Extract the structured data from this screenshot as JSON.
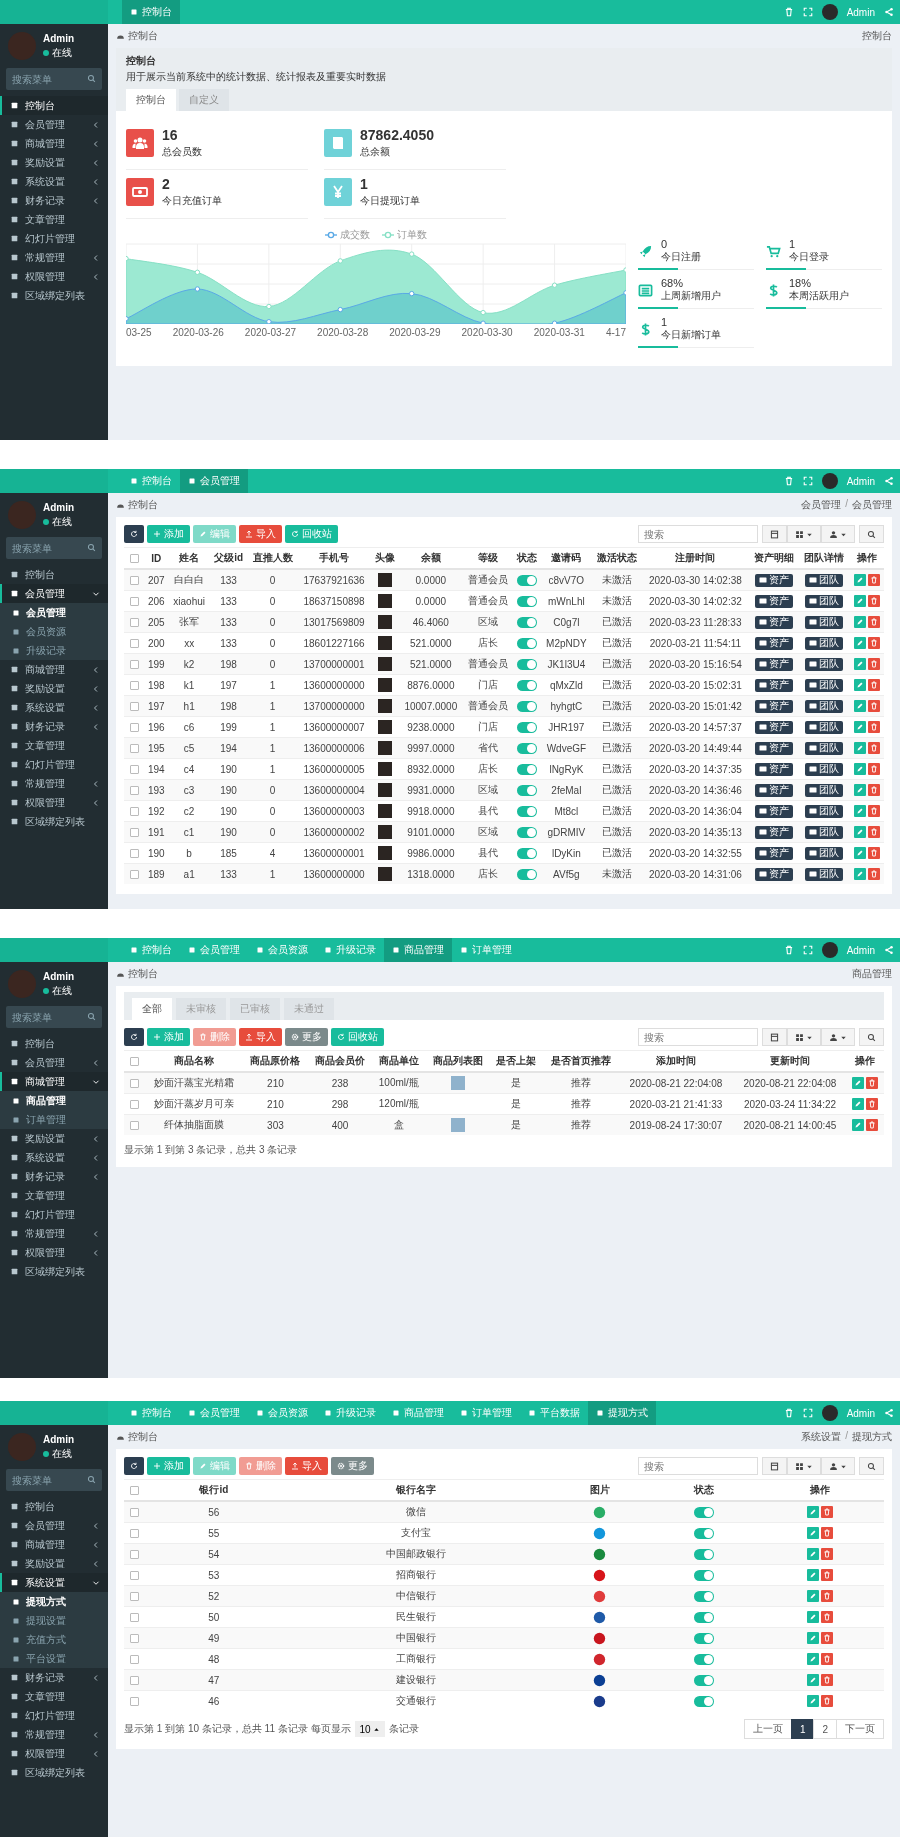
{
  "panels": [
    {
      "user": {
        "name": "Admin",
        "status": "在线"
      },
      "sidebar": {
        "search_placeholder": "搜索菜单",
        "items": [
          {
            "label": "控制台",
            "kind": "link",
            "selected": true
          },
          {
            "label": "会员管理",
            "kind": "group",
            "expanded": false,
            "selected": false
          },
          {
            "label": "商城管理",
            "kind": "group",
            "expanded": false,
            "selected": false
          },
          {
            "label": "奖励设置",
            "kind": "group",
            "expanded": false,
            "selected": false
          },
          {
            "label": "系统设置",
            "kind": "group",
            "expanded": false,
            "selected": false
          },
          {
            "label": "财务记录",
            "kind": "group",
            "expanded": false,
            "selected": false
          },
          {
            "label": "文章管理",
            "kind": "link",
            "selected": false
          },
          {
            "label": "幻灯片管理",
            "kind": "link",
            "selected": false
          },
          {
            "label": "常规管理",
            "kind": "group",
            "expanded": false,
            "selected": false
          },
          {
            "label": "权限管理",
            "kind": "group",
            "expanded": false,
            "selected": false
          },
          {
            "label": "区域绑定列表",
            "kind": "link",
            "selected": false
          }
        ]
      },
      "topbar": {
        "tabs": [
          {
            "label": "控制台",
            "selected": true
          }
        ],
        "user_name": "Admin"
      },
      "breadcrumb": {
        "home": "控制台",
        "trail": [
          "控制台"
        ]
      },
      "content": {
        "kind": "dashboard",
        "title": "控制台",
        "description": "用于展示当前系统中的统计数据、统计报表及重要实时数据",
        "tabs": [
          {
            "label": "控制台",
            "selected": true
          },
          {
            "label": "自定义",
            "selected": false
          }
        ],
        "stats": [
          {
            "value": "16",
            "label": "总会员数",
            "color": "#e8504a"
          },
          {
            "value": "87862.4050",
            "label": "总余额",
            "color": "#6fd2d8"
          },
          {
            "value": "2",
            "label": "今日充值订单",
            "color": "#e8504a"
          },
          {
            "value": "1",
            "label": "今日提现订单",
            "color": "#6fd2d8"
          }
        ],
        "chart": {
          "legend": [
            "成交数",
            "订单数"
          ],
          "x_labels": [
            "03-25",
            "2020-03-26",
            "2020-03-27",
            "2020-03-28",
            "2020-03-29",
            "2020-03-30",
            "2020-03-31",
            "4-17"
          ]
        },
        "mini_stats": [
          {
            "value": "0",
            "label": "今日注册"
          },
          {
            "value": "1",
            "label": "今日登录"
          },
          {
            "value": "68%",
            "label": "上周新增用户"
          },
          {
            "value": "18%",
            "label": "本周活跃用户"
          },
          {
            "value": "1",
            "label": "今日新增订单"
          }
        ]
      }
    },
    {
      "user": {
        "name": "Admin",
        "status": "在线"
      },
      "sidebar": {
        "search_placeholder": "搜索菜单",
        "items": [
          {
            "label": "控制台",
            "kind": "link",
            "selected": false
          },
          {
            "label": "会员管理",
            "kind": "group",
            "expanded": true,
            "selected": true,
            "children": [
              {
                "label": "会员管理",
                "selected": true
              },
              {
                "label": "会员资源",
                "selected": false
              },
              {
                "label": "升级记录",
                "selected": false
              }
            ]
          },
          {
            "label": "商城管理",
            "kind": "group",
            "expanded": false,
            "selected": false
          },
          {
            "label": "奖励设置",
            "kind": "group",
            "expanded": false,
            "selected": false
          },
          {
            "label": "系统设置",
            "kind": "group",
            "expanded": false,
            "selected": false
          },
          {
            "label": "财务记录",
            "kind": "group",
            "expanded": false,
            "selected": false
          },
          {
            "label": "文章管理",
            "kind": "link",
            "selected": false
          },
          {
            "label": "幻灯片管理",
            "kind": "link",
            "selected": false
          },
          {
            "label": "常规管理",
            "kind": "group",
            "expanded": false,
            "selected": false
          },
          {
            "label": "权限管理",
            "kind": "group",
            "expanded": false,
            "selected": false
          },
          {
            "label": "区域绑定列表",
            "kind": "link",
            "selected": false
          }
        ]
      },
      "topbar": {
        "tabs": [
          {
            "label": "控制台",
            "selected": false
          },
          {
            "label": "会员管理",
            "selected": true
          }
        ],
        "user_name": "Admin"
      },
      "breadcrumb": {
        "home": "控制台",
        "separator": "/",
        "trail": [
          "会员管理",
          "会员管理"
        ]
      },
      "content": {
        "kind": "table",
        "search_placeholder": "搜索",
        "toolbar": [
          {
            "kind": "refresh",
            "disabled": false
          },
          {
            "kind": "add",
            "label": "添加",
            "disabled": false
          },
          {
            "kind": "edit",
            "label": "编辑",
            "disabled": true
          },
          {
            "kind": "import",
            "label": "导入",
            "disabled": false
          },
          {
            "kind": "recycle",
            "label": "回收站",
            "disabled": false
          }
        ],
        "header_checked": false,
        "columns": [
          "ID",
          "姓名",
          "父级id",
          "直推人数",
          "手机号",
          "头像",
          "余额",
          "等级",
          "状态",
          "邀请码",
          "激活状态",
          "注册时间",
          "资产明细",
          "团队详情",
          "操作"
        ],
        "rows": [
          {
            "checked": false,
            "cells": [
              "207",
              "白白白",
              "133",
              "0",
              "17637921636",
              {
                "kind": "avatar"
              },
              "0.0000",
              "普通会员",
              {
                "kind": "toggle",
                "on": true
              },
              "c8vV7O",
              "未激活",
              "2020-03-30 14:02:38",
              {
                "kind": "tag",
                "text": "资产"
              },
              {
                "kind": "tag",
                "text": "团队"
              },
              {
                "kind": "actions"
              }
            ]
          },
          {
            "checked": false,
            "cells": [
              "206",
              "xiaohui",
              "133",
              "0",
              "18637150898",
              {
                "kind": "avatar"
              },
              "0.0000",
              "普通会员",
              {
                "kind": "toggle",
                "on": true
              },
              "mWnLhl",
              "未激活",
              "2020-03-30 14:02:32",
              {
                "kind": "tag",
                "text": "资产"
              },
              {
                "kind": "tag",
                "text": "团队"
              },
              {
                "kind": "actions"
              }
            ]
          },
          {
            "checked": false,
            "cells": [
              "205",
              "张军",
              "133",
              "0",
              "13017569809",
              {
                "kind": "avatar"
              },
              "46.4060",
              "区域",
              {
                "kind": "toggle",
                "on": true
              },
              "C0g7l",
              "已激活",
              "2020-03-23 11:28:33",
              {
                "kind": "tag",
                "text": "资产"
              },
              {
                "kind": "tag",
                "text": "团队"
              },
              {
                "kind": "actions"
              }
            ]
          },
          {
            "checked": false,
            "cells": [
              "200",
              "xx",
              "133",
              "0",
              "18601227166",
              {
                "kind": "avatar"
              },
              "521.0000",
              "店长",
              {
                "kind": "toggle",
                "on": true
              },
              "M2pNDY",
              "已激活",
              "2020-03-21 11:54:11",
              {
                "kind": "tag",
                "text": "资产"
              },
              {
                "kind": "tag",
                "text": "团队"
              },
              {
                "kind": "actions"
              }
            ]
          },
          {
            "checked": false,
            "cells": [
              "199",
              "k2",
              "198",
              "0",
              "13700000001",
              {
                "kind": "avatar"
              },
              "521.0000",
              "普通会员",
              {
                "kind": "toggle",
                "on": true
              },
              "JK1l3U4",
              "已激活",
              "2020-03-20 15:16:54",
              {
                "kind": "tag",
                "text": "资产"
              },
              {
                "kind": "tag",
                "text": "团队"
              },
              {
                "kind": "actions"
              }
            ]
          },
          {
            "checked": false,
            "cells": [
              "198",
              "k1",
              "197",
              "1",
              "13600000000",
              {
                "kind": "avatar"
              },
              "8876.0000",
              "门店",
              {
                "kind": "toggle",
                "on": true
              },
              "qMxZld",
              "已激活",
              "2020-03-20 15:02:31",
              {
                "kind": "tag",
                "text": "资产"
              },
              {
                "kind": "tag",
                "text": "团队"
              },
              {
                "kind": "actions"
              }
            ]
          },
          {
            "checked": false,
            "cells": [
              "197",
              "h1",
              "198",
              "1",
              "13700000000",
              {
                "kind": "avatar"
              },
              "10007.0000",
              "普通会员",
              {
                "kind": "toggle",
                "on": true
              },
              "hyhgtC",
              "已激活",
              "2020-03-20 15:01:42",
              {
                "kind": "tag",
                "text": "资产"
              },
              {
                "kind": "tag",
                "text": "团队"
              },
              {
                "kind": "actions"
              }
            ]
          },
          {
            "checked": false,
            "cells": [
              "196",
              "c6",
              "199",
              "1",
              "13600000007",
              {
                "kind": "avatar"
              },
              "9238.0000",
              "门店",
              {
                "kind": "toggle",
                "on": true
              },
              "JHR197",
              "已激活",
              "2020-03-20 14:57:37",
              {
                "kind": "tag",
                "text": "资产"
              },
              {
                "kind": "tag",
                "text": "团队"
              },
              {
                "kind": "actions"
              }
            ]
          },
          {
            "checked": false,
            "cells": [
              "195",
              "c5",
              "194",
              "1",
              "13600000006",
              {
                "kind": "avatar"
              },
              "9997.0000",
              "省代",
              {
                "kind": "toggle",
                "on": true
              },
              "WdveGF",
              "已激活",
              "2020-03-20 14:49:44",
              {
                "kind": "tag",
                "text": "资产"
              },
              {
                "kind": "tag",
                "text": "团队"
              },
              {
                "kind": "actions"
              }
            ]
          },
          {
            "checked": false,
            "cells": [
              "194",
              "c4",
              "190",
              "1",
              "13600000005",
              {
                "kind": "avatar"
              },
              "8932.0000",
              "店长",
              {
                "kind": "toggle",
                "on": true
              },
              "lNgRyK",
              "已激活",
              "2020-03-20 14:37:35",
              {
                "kind": "tag",
                "text": "资产"
              },
              {
                "kind": "tag",
                "text": "团队"
              },
              {
                "kind": "actions"
              }
            ]
          },
          {
            "checked": false,
            "cells": [
              "193",
              "c3",
              "190",
              "0",
              "13600000004",
              {
                "kind": "avatar"
              },
              "9931.0000",
              "区域",
              {
                "kind": "toggle",
                "on": true
              },
              "2feMal",
              "已激活",
              "2020-03-20 14:36:46",
              {
                "kind": "tag",
                "text": "资产"
              },
              {
                "kind": "tag",
                "text": "团队"
              },
              {
                "kind": "actions"
              }
            ]
          },
          {
            "checked": false,
            "cells": [
              "192",
              "c2",
              "190",
              "0",
              "13600000003",
              {
                "kind": "avatar"
              },
              "9918.0000",
              "县代",
              {
                "kind": "toggle",
                "on": true
              },
              "Mt8cl",
              "已激活",
              "2020-03-20 14:36:04",
              {
                "kind": "tag",
                "text": "资产"
              },
              {
                "kind": "tag",
                "text": "团队"
              },
              {
                "kind": "actions"
              }
            ]
          },
          {
            "checked": false,
            "cells": [
              "191",
              "c1",
              "190",
              "0",
              "13600000002",
              {
                "kind": "avatar"
              },
              "9101.0000",
              "区域",
              {
                "kind": "toggle",
                "on": true
              },
              "gDRMIV",
              "已激活",
              "2020-03-20 14:35:13",
              {
                "kind": "tag",
                "text": "资产"
              },
              {
                "kind": "tag",
                "text": "团队"
              },
              {
                "kind": "actions"
              }
            ]
          },
          {
            "checked": false,
            "cells": [
              "190",
              "b",
              "185",
              "4",
              "13600000001",
              {
                "kind": "avatar"
              },
              "9986.0000",
              "县代",
              {
                "kind": "toggle",
                "on": true
              },
              "lDyKin",
              "已激活",
              "2020-03-20 14:32:55",
              {
                "kind": "tag",
                "text": "资产"
              },
              {
                "kind": "tag",
                "text": "团队"
              },
              {
                "kind": "actions"
              }
            ]
          },
          {
            "checked": false,
            "cells": [
              "189",
              "a1",
              "133",
              "1",
              "13600000000",
              {
                "kind": "avatar"
              },
              "1318.0000",
              "店长",
              {
                "kind": "toggle",
                "on": true
              },
              "AVf5g",
              "未激活",
              "2020-03-20 14:31:06",
              {
                "kind": "tag",
                "text": "资产"
              },
              {
                "kind": "tag",
                "text": "团队"
              },
              {
                "kind": "actions"
              }
            ]
          }
        ]
      }
    },
    {
      "user": {
        "name": "Admin",
        "status": "在线"
      },
      "sidebar": {
        "search_placeholder": "搜索菜单",
        "items": [
          {
            "label": "控制台",
            "kind": "link",
            "selected": false
          },
          {
            "label": "会员管理",
            "kind": "group",
            "expanded": false,
            "selected": false
          },
          {
            "label": "商城管理",
            "kind": "group",
            "expanded": true,
            "selected": true,
            "children": [
              {
                "label": "商品管理",
                "selected": true
              },
              {
                "label": "订单管理",
                "selected": false
              }
            ]
          },
          {
            "label": "奖励设置",
            "kind": "group",
            "expanded": false,
            "selected": false
          },
          {
            "label": "系统设置",
            "kind": "group",
            "expanded": false,
            "selected": false
          },
          {
            "label": "财务记录",
            "kind": "group",
            "expanded": false,
            "selected": false
          },
          {
            "label": "文章管理",
            "kind": "link",
            "selected": false
          },
          {
            "label": "幻灯片管理",
            "kind": "link",
            "selected": false
          },
          {
            "label": "常规管理",
            "kind": "group",
            "expanded": false,
            "selected": false
          },
          {
            "label": "权限管理",
            "kind": "group",
            "expanded": false,
            "selected": false
          },
          {
            "label": "区域绑定列表",
            "kind": "link",
            "selected": false
          }
        ]
      },
      "topbar": {
        "tabs": [
          {
            "label": "控制台",
            "selected": false
          },
          {
            "label": "会员管理",
            "selected": false
          },
          {
            "label": "会员资源",
            "selected": false
          },
          {
            "label": "升级记录",
            "selected": false
          },
          {
            "label": "商品管理",
            "selected": true
          },
          {
            "label": "订单管理",
            "selected": false
          }
        ],
        "user_name": "Admin"
      },
      "breadcrumb": {
        "home": "控制台",
        "trail": [
          "商品管理"
        ]
      },
      "content": {
        "kind": "table",
        "search_placeholder": "搜索",
        "filter_tabs": [
          {
            "label": "全部",
            "selected": true
          },
          {
            "label": "未审核",
            "selected": false
          },
          {
            "label": "已审核",
            "selected": false
          },
          {
            "label": "未通过",
            "selected": false
          }
        ],
        "toolbar": [
          {
            "kind": "refresh",
            "disabled": false
          },
          {
            "kind": "add",
            "label": "添加",
            "disabled": false
          },
          {
            "kind": "delete",
            "label": "删除",
            "disabled": true
          },
          {
            "kind": "import",
            "label": "导入",
            "disabled": false
          },
          {
            "kind": "more",
            "label": "更多",
            "disabled": false
          },
          {
            "kind": "recycle",
            "label": "回收站",
            "disabled": false
          }
        ],
        "header_checked": false,
        "columns": [
          "商品名称",
          "商品原价格",
          "商品会员价",
          "商品单位",
          "商品列表图",
          "是否上架",
          "是否首页推荐",
          "添加时间",
          "更新时间",
          "操作"
        ],
        "rows": [
          {
            "checked": false,
            "cells": [
              "妙面汗蒸宝光精霜",
              "210",
              "238",
              "100ml/瓶",
              {
                "kind": "image"
              },
              "是",
              "推荐",
              "2020-08-21 22:04:08",
              "2020-08-21 22:04:08",
              {
                "kind": "actions"
              }
            ]
          },
          {
            "checked": false,
            "cells": [
              "妙面汗蒸岁月可亲",
              "210",
              "298",
              "120ml/瓶",
              {
                "kind": "empty"
              },
              "是",
              "推荐",
              "2020-03-21 21:41:33",
              "2020-03-24 11:34:22",
              {
                "kind": "actions"
              }
            ]
          },
          {
            "checked": false,
            "cells": [
              "纤体抽脂面膜",
              "303",
              "400",
              "盒",
              {
                "kind": "image"
              },
              "是",
              "推荐",
              "2019-08-24 17:30:07",
              "2020-08-21 14:00:45",
              {
                "kind": "actions"
              }
            ]
          }
        ],
        "footer": {
          "summary": "显示第 1 到第 3 条记录，总共 3 条记录"
        }
      }
    },
    {
      "user": {
        "name": "Admin",
        "status": "在线"
      },
      "sidebar": {
        "search_placeholder": "搜索菜单",
        "items": [
          {
            "label": "控制台",
            "kind": "link",
            "selected": false
          },
          {
            "label": "会员管理",
            "kind": "group",
            "expanded": false,
            "selected": false
          },
          {
            "label": "商城管理",
            "kind": "group",
            "expanded": false,
            "selected": false
          },
          {
            "label": "奖励设置",
            "kind": "group",
            "expanded": false,
            "selected": false
          },
          {
            "label": "系统设置",
            "kind": "group",
            "expanded": true,
            "selected": true,
            "children": [
              {
                "label": "提现方式",
                "selected": true
              },
              {
                "label": "提现设置",
                "selected": false
              },
              {
                "label": "充值方式",
                "selected": false
              },
              {
                "label": "平台设置",
                "selected": false
              }
            ]
          },
          {
            "label": "财务记录",
            "kind": "group",
            "expanded": false,
            "selected": false
          },
          {
            "label": "文章管理",
            "kind": "link",
            "selected": false
          },
          {
            "label": "幻灯片管理",
            "kind": "link",
            "selected": false
          },
          {
            "label": "常规管理",
            "kind": "group",
            "expanded": false,
            "selected": false
          },
          {
            "label": "权限管理",
            "kind": "group",
            "expanded": false,
            "selected": false
          },
          {
            "label": "区域绑定列表",
            "kind": "link",
            "selected": false
          }
        ]
      },
      "topbar": {
        "tabs": [
          {
            "label": "控制台",
            "selected": false
          },
          {
            "label": "会员管理",
            "selected": false
          },
          {
            "label": "会员资源",
            "selected": false
          },
          {
            "label": "升级记录",
            "selected": false
          },
          {
            "label": "商品管理",
            "selected": false
          },
          {
            "label": "订单管理",
            "selected": false
          },
          {
            "label": "平台数据",
            "selected": false
          },
          {
            "label": "提现方式",
            "selected": true
          }
        ],
        "user_name": "Admin"
      },
      "breadcrumb": {
        "home": "控制台",
        "separator": "/",
        "trail": [
          "系统设置",
          "提现方式"
        ]
      },
      "content": {
        "kind": "table",
        "search_placeholder": "搜索",
        "toolbar": [
          {
            "kind": "refresh",
            "disabled": false
          },
          {
            "kind": "add",
            "label": "添加",
            "disabled": false
          },
          {
            "kind": "edit",
            "label": "编辑",
            "disabled": true
          },
          {
            "kind": "delete",
            "label": "删除",
            "disabled": true
          },
          {
            "kind": "import",
            "label": "导入",
            "disabled": false
          },
          {
            "kind": "more",
            "label": "更多",
            "disabled": false
          }
        ],
        "header_checked": false,
        "columns": [
          "银行id",
          "银行名字",
          "图片",
          "状态",
          "操作"
        ],
        "rows": [
          {
            "checked": false,
            "cells": [
              "56",
              "微信",
              {
                "kind": "logo",
                "color": "#2aae67"
              },
              {
                "kind": "toggle",
                "on": true
              },
              {
                "kind": "actions"
              }
            ]
          },
          {
            "checked": false,
            "cells": [
              "55",
              "支付宝",
              {
                "kind": "logo",
                "color": "#1296db"
              },
              {
                "kind": "toggle",
                "on": true
              },
              {
                "kind": "actions"
              }
            ]
          },
          {
            "checked": false,
            "cells": [
              "54",
              "中国邮政银行",
              {
                "kind": "logo",
                "color": "#1a8a3f"
              },
              {
                "kind": "toggle",
                "on": true
              },
              {
                "kind": "actions"
              }
            ]
          },
          {
            "checked": false,
            "cells": [
              "53",
              "招商银行",
              {
                "kind": "logo",
                "color": "#d7141a"
              },
              {
                "kind": "toggle",
                "on": true
              },
              {
                "kind": "actions"
              }
            ]
          },
          {
            "checked": false,
            "cells": [
              "52",
              "中信银行",
              {
                "kind": "logo",
                "color": "#e03c3c"
              },
              {
                "kind": "toggle",
                "on": true
              },
              {
                "kind": "actions"
              }
            ]
          },
          {
            "checked": false,
            "cells": [
              "50",
              "民生银行",
              {
                "kind": "logo",
                "color": "#1f5aa8"
              },
              {
                "kind": "toggle",
                "on": true
              },
              {
                "kind": "actions"
              }
            ]
          },
          {
            "checked": false,
            "cells": [
              "49",
              "中国银行",
              {
                "kind": "logo",
                "color": "#c8161e"
              },
              {
                "kind": "toggle",
                "on": true
              },
              {
                "kind": "actions"
              }
            ]
          },
          {
            "checked": false,
            "cells": [
              "48",
              "工商银行",
              {
                "kind": "logo",
                "color": "#d0262d"
              },
              {
                "kind": "toggle",
                "on": true
              },
              {
                "kind": "actions"
              }
            ]
          },
          {
            "checked": false,
            "cells": [
              "47",
              "建设银行",
              {
                "kind": "logo",
                "color": "#0b3f94"
              },
              {
                "kind": "toggle",
                "on": true
              },
              {
                "kind": "actions"
              }
            ]
          },
          {
            "checked": false,
            "cells": [
              "46",
              "交通银行",
              {
                "kind": "logo",
                "color": "#1a3c8c"
              },
              {
                "kind": "toggle",
                "on": true
              },
              {
                "kind": "actions"
              }
            ]
          }
        ],
        "footer": {
          "summary": "显示第 1 到第 10 条记录，总共 11 条记录 每页显示",
          "page_size": "10",
          "page_size_suffix": "条记录",
          "pages": [
            {
              "label": "上一页",
              "selected": false
            },
            {
              "label": "1",
              "selected": true
            },
            {
              "label": "2",
              "selected": false
            },
            {
              "label": "下一页",
              "selected": false
            }
          ]
        }
      }
    }
  ]
}
